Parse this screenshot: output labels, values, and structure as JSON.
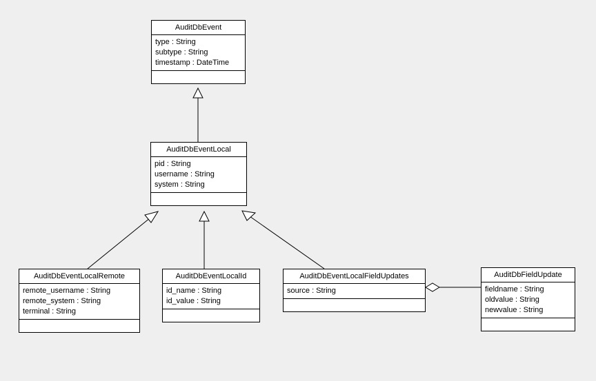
{
  "classes": {
    "AuditDbEvent": {
      "name": "AuditDbEvent",
      "attrs": [
        "type : String",
        "subtype : String",
        "timestamp : DateTime"
      ]
    },
    "AuditDbEventLocal": {
      "name": "AuditDbEventLocal",
      "attrs": [
        "pid : String",
        "username : String",
        "system : String"
      ]
    },
    "AuditDbEventLocalRemote": {
      "name": "AuditDbEventLocalRemote",
      "attrs": [
        "remote_username : String",
        "remote_system : String",
        "terminal : String"
      ]
    },
    "AuditDbEventLocalId": {
      "name": "AuditDbEventLocalId",
      "attrs": [
        "id_name : String",
        "id_value : String"
      ]
    },
    "AuditDbEventLocalFieldUpdates": {
      "name": "AuditDbEventLocalFieldUpdates",
      "attrs": [
        "source : String"
      ]
    },
    "AuditDbFieldUpdate": {
      "name": "AuditDbFieldUpdate",
      "attrs": [
        "fieldname : String",
        "oldvalue : String",
        "newvalue : String"
      ]
    }
  }
}
